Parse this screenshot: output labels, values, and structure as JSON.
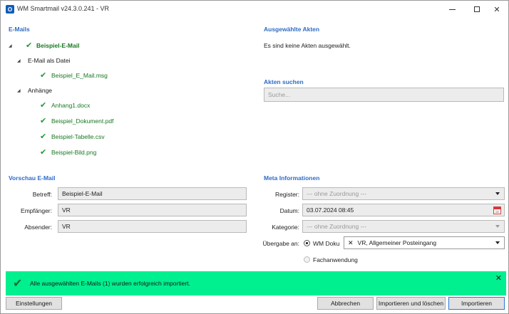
{
  "window": {
    "title": "WM Smartmail v24.3.0.241 - VR",
    "app_icon_letter": "O"
  },
  "emails": {
    "title": "E-Mails",
    "root": "Beispiel-E-Mail",
    "file_group": "E-Mail als Datei",
    "file_item": "Beispiel_E_Mail.msg",
    "attachments_group": "Anhänge",
    "attachments": [
      "Anhang1.docx",
      "Beispiel_Dokument.pdf",
      "Beispiel-Tabelle.csv",
      "Beispiel-Bild.png"
    ]
  },
  "selected_files": {
    "title": "Ausgewählte Akten",
    "empty_text": "Es sind keine Akten ausgewählt."
  },
  "search": {
    "title": "Akten suchen",
    "placeholder": "Suche..."
  },
  "preview": {
    "title": "Vorschau E-Mail",
    "subject_label": "Betreff:",
    "subject_value": "Beispiel-E-Mail",
    "recipient_label": "Empfänger:",
    "recipient_value": "VR",
    "sender_label": "Absender:",
    "sender_value": "VR"
  },
  "meta": {
    "title": "Meta Informationen",
    "register_label": "Register:",
    "register_value": "--- ohne Zuordnung ---",
    "date_label": "Datum:",
    "date_value": "03.07.2024 08:45",
    "category_label": "Kategorie:",
    "category_value": "--- ohne Zuordnung ---",
    "transfer_label": "Übergabe an:",
    "option_wm_doku": "WM Doku",
    "option_fachanwendung": "Fachanwendung",
    "target_value": "VR, Allgemeiner Posteingang"
  },
  "banner": {
    "message": "Alle ausgewählten E-Mails (1) wurden erfolgreich importiert.",
    "color": "#00ef8f"
  },
  "buttons": {
    "settings": "Einstellungen",
    "cancel": "Abbrechen",
    "import_delete": "Importieren und löschen",
    "import": "Importieren"
  },
  "colors": {
    "accent": "#2f6cc5",
    "success": "#1e9a32"
  }
}
